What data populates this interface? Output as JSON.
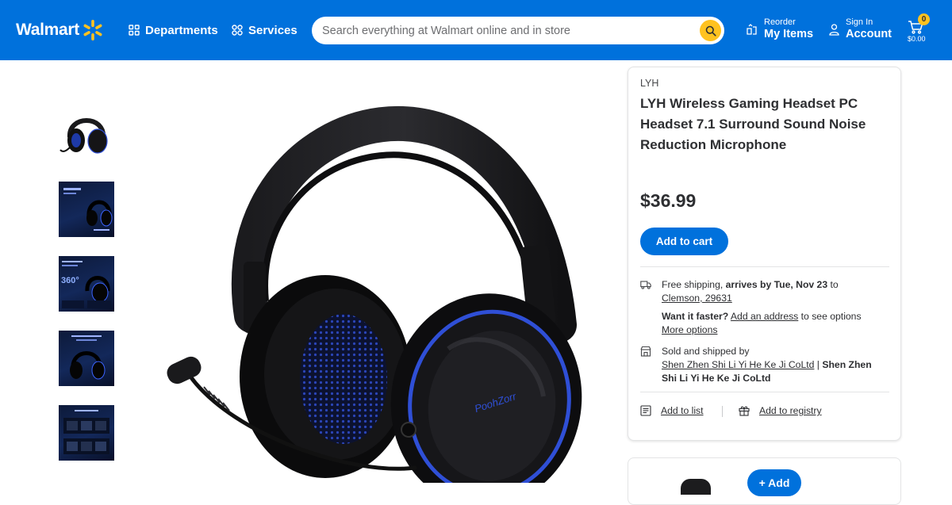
{
  "header": {
    "logo_text": "Walmart",
    "departments_label": "Departments",
    "services_label": "Services",
    "search_placeholder": "Search everything at Walmart online and in store",
    "reorder_small": "Reorder",
    "reorder_big": "My Items",
    "signin_small": "Sign In",
    "signin_big": "Account",
    "cart_count": "0",
    "cart_total": "$0.00"
  },
  "gallery": {
    "thumbnail_count": 5,
    "active_index": 0
  },
  "product": {
    "brand": "LYH",
    "title": "LYH Wireless Gaming Headset PC Headset 7.1 Surround Sound Noise Reduction Microphone",
    "price": "$36.99",
    "add_to_cart_label": "Add to cart",
    "image_brand_text": "PoohZorr"
  },
  "fulfillment": {
    "shipping_prefix": "Free shipping, ",
    "shipping_bold": "arrives by Tue, Nov 23",
    "shipping_suffix": " to",
    "location": "Clemson, 29631",
    "faster_bold": "Want it faster?",
    "add_address": "Add an address",
    "faster_suffix": " to see options",
    "more_options": "More options",
    "sold_by_label": "Sold and shipped by",
    "seller_link": "Shen Zhen Shi Li Yi He Ke Ji CoLtd",
    "seller_sep": " | ",
    "seller_bold": "Shen Zhen Shi Li Yi He Ke Ji CoLtd"
  },
  "actions": {
    "add_to_list": "Add to list",
    "add_to_registry": "Add to registry"
  },
  "secondary_card": {
    "add_label": "+ Add"
  },
  "colors": {
    "brand_blue": "#0071dc",
    "spark_yellow": "#ffc220",
    "text_dark": "#2e2f32",
    "headset_accent_blue": "#2f4fd6"
  }
}
